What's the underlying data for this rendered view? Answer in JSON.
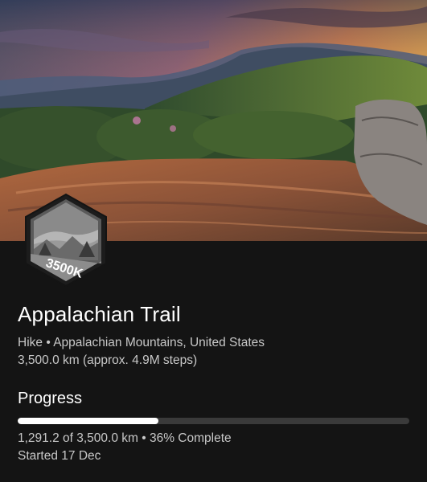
{
  "hero": {
    "image": "mountain-sunset-photo"
  },
  "badge": {
    "label": "3500K",
    "icon": "mountain-badge-icon"
  },
  "trail": {
    "title": "Appalachian Trail",
    "type_line": "Hike • Appalachian Mountains, United States",
    "distance_line": "3,500.0 km (approx. 4.9M steps)"
  },
  "progress": {
    "heading": "Progress",
    "fraction": 0.36,
    "summary": "1,291.2 of 3,500.0 km • 36% Complete",
    "started": "Started 17 Dec"
  },
  "colors": {
    "background": "#141414",
    "bar_track": "#3a3a3a",
    "bar_fill": "#ffffff",
    "secondary_text": "#c8c8c8"
  }
}
